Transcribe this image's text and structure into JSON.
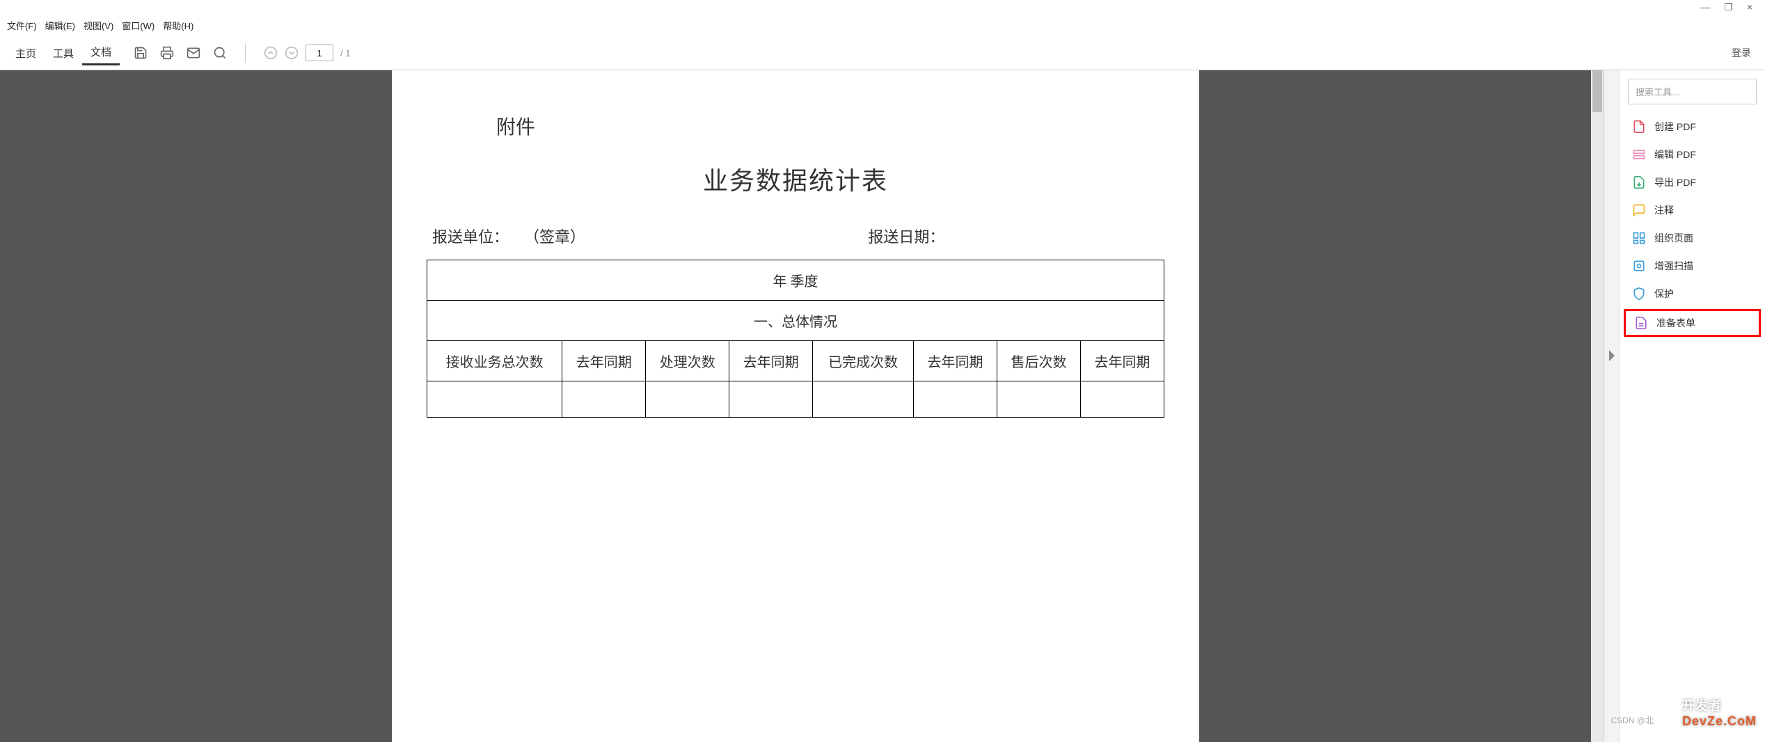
{
  "window": {
    "close": "×",
    "restore": "❐",
    "minimize": "—"
  },
  "menubar": {
    "file": "文件(F)",
    "edit": "编辑(E)",
    "view": "视图(V)",
    "window": "窗口(W)",
    "help": "帮助(H)"
  },
  "toolbar": {
    "tabs": {
      "home": "主页",
      "tools": "工具",
      "doc": "文档"
    },
    "page_value": "1",
    "page_total": "/ 1",
    "login": "登录"
  },
  "document": {
    "attach_label": "附件",
    "title": "业务数据统计表",
    "report_unit_label": "报送单位：",
    "signature_label": "（签章）",
    "report_date_label": "报送日期：",
    "table": {
      "row1": "年  季度",
      "row2": "一、总体情况",
      "headers": [
        "接收业务总次数",
        "去年同期",
        "处理次数",
        "去年同期",
        "已完成次数",
        "去年同期",
        "售后次数",
        "去年同期"
      ]
    }
  },
  "tools_panel": {
    "search_placeholder": "搜索工具...",
    "items": {
      "create": "创建 PDF",
      "edit": "编辑 PDF",
      "export": "导出 PDF",
      "comment": "注释",
      "organize": "组织页面",
      "enhance": "增强扫描",
      "protect": "保护",
      "form": "准备表单"
    }
  },
  "watermark": {
    "csdn": "CSDN @北",
    "brand_a": "开发者",
    "brand_b": "DevZe.CoM"
  }
}
